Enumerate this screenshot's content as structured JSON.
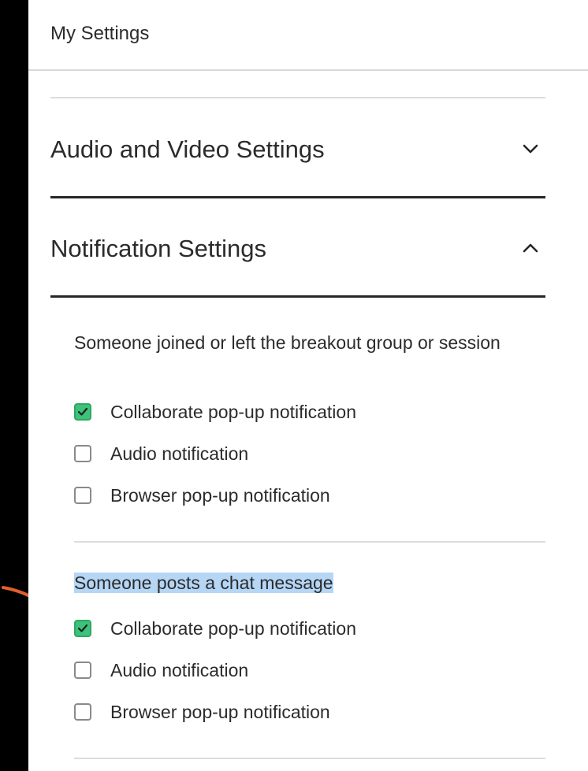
{
  "header": {
    "title": "My Settings"
  },
  "sections": [
    {
      "title": "Audio and Video Settings",
      "state": "collapsed",
      "icon": "chevron-down-icon"
    },
    {
      "title": "Notification Settings",
      "state": "expanded",
      "icon": "chevron-up-icon"
    }
  ],
  "groups": [
    {
      "title": "Someone joined or left the breakout group or session",
      "options": [
        {
          "label": "Collaborate pop-up notification",
          "checked": true
        },
        {
          "label": "Audio notification",
          "checked": false
        },
        {
          "label": "Browser pop-up notification",
          "checked": false
        }
      ]
    },
    {
      "title": "Someone posts a chat message",
      "highlighted": true,
      "options": [
        {
          "label": "Collaborate pop-up notification",
          "checked": true
        },
        {
          "label": "Audio notification",
          "checked": false
        },
        {
          "label": "Browser pop-up notification",
          "checked": false
        }
      ]
    }
  ],
  "colors": {
    "checkbox_checked": "#3cc27a",
    "selection_highlight": "#b5d6f5",
    "annotation_arrow": "#e0602a"
  }
}
